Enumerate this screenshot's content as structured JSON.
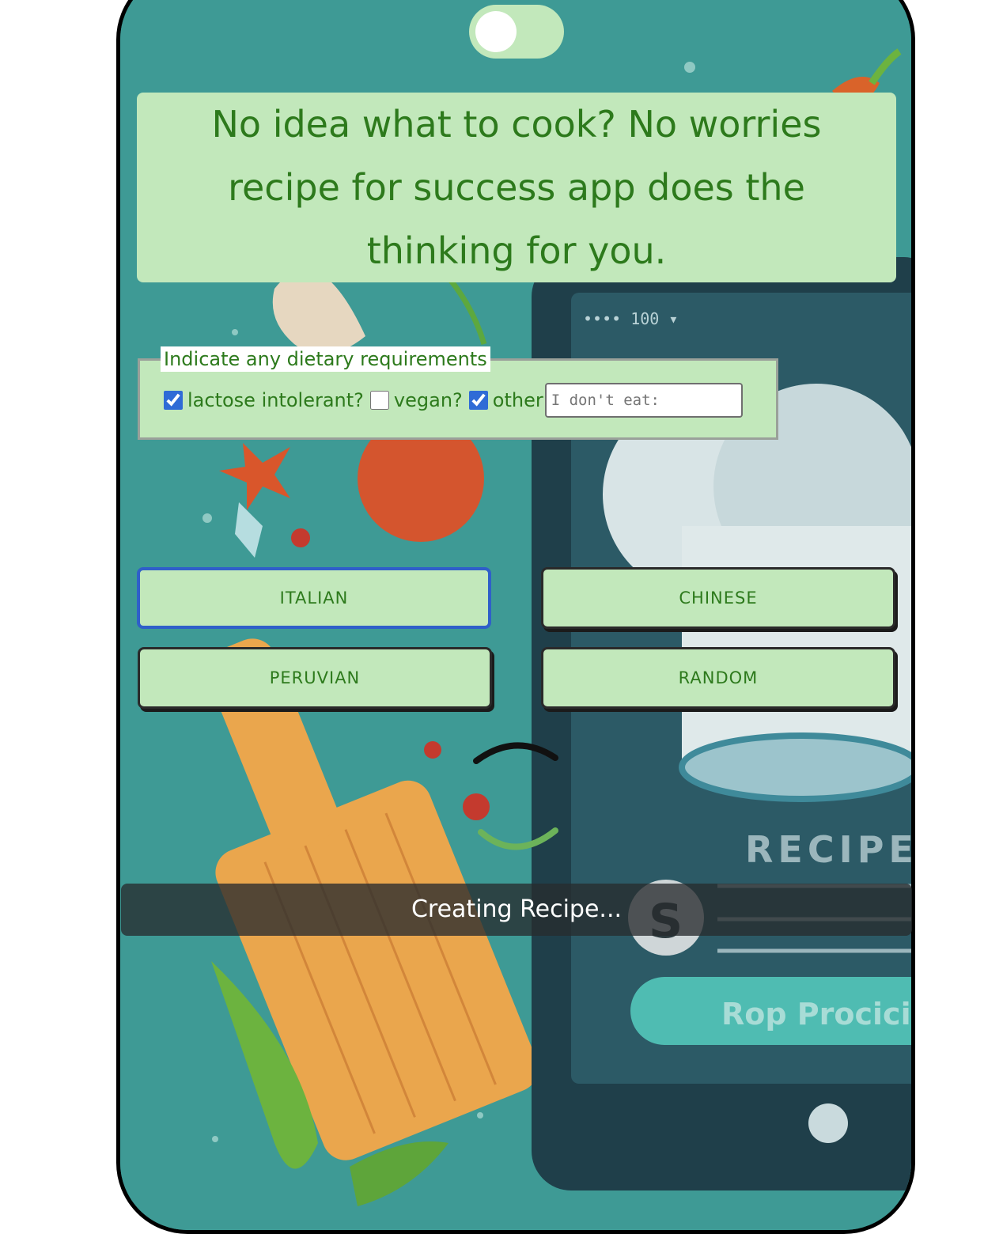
{
  "toggle": {
    "state": "on"
  },
  "headline": {
    "text": "No idea what to cook? No worries recipe for success app does the thinking for you."
  },
  "dietary": {
    "legend": "Indicate any dietary requirements",
    "options": [
      {
        "label": "lactose intolerant?",
        "checked": true
      },
      {
        "label": "vegan?",
        "checked": false
      },
      {
        "label": "other",
        "checked": true
      }
    ],
    "other_placeholder": "I don't eat:"
  },
  "cuisines": [
    {
      "label": "ITALIAN"
    },
    {
      "label": "CHINESE"
    },
    {
      "label": "PERUVIAN"
    },
    {
      "label": "RANDOM"
    }
  ],
  "status": {
    "text": "Creating Recipe..."
  },
  "background": {
    "phone_screen": {
      "status_text": "•••• 100 ▾",
      "title": "RECIPE",
      "badge": "S",
      "button": "Rop Procicic"
    }
  },
  "colors": {
    "panel": "#c2e8bb",
    "text": "#2d7a1c",
    "background": "#3e9a95"
  }
}
